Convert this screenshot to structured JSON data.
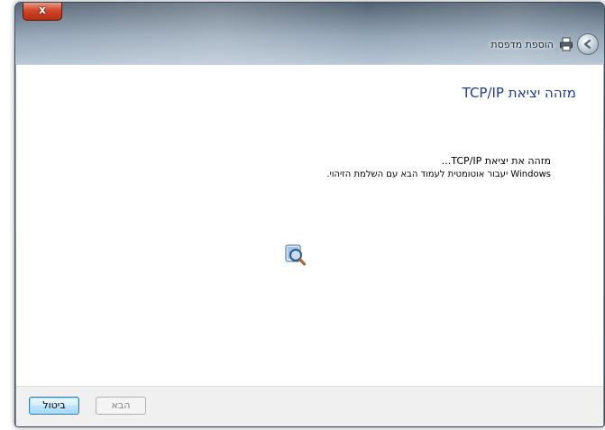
{
  "window": {
    "close_label": "x",
    "nav_title": "הוספת מדפסת"
  },
  "main": {
    "heading": "מזהה יציאת TCP/IP",
    "message_line1": "מזהה את יציאת TCP/IP...",
    "message_line2": "Windows יעבור אוטומטית לעמוד הבא עם השלמת הזיהוי."
  },
  "footer": {
    "cancel_label": "ביטול",
    "next_label": "הבא"
  },
  "icons": {
    "back": "back-arrow-icon",
    "printer": "printer-icon",
    "progress": "search-magnifier-icon"
  },
  "colors": {
    "heading": "#1e3c8c",
    "close_button": "#c8391c",
    "footer_bg": "#f0f0f0"
  }
}
